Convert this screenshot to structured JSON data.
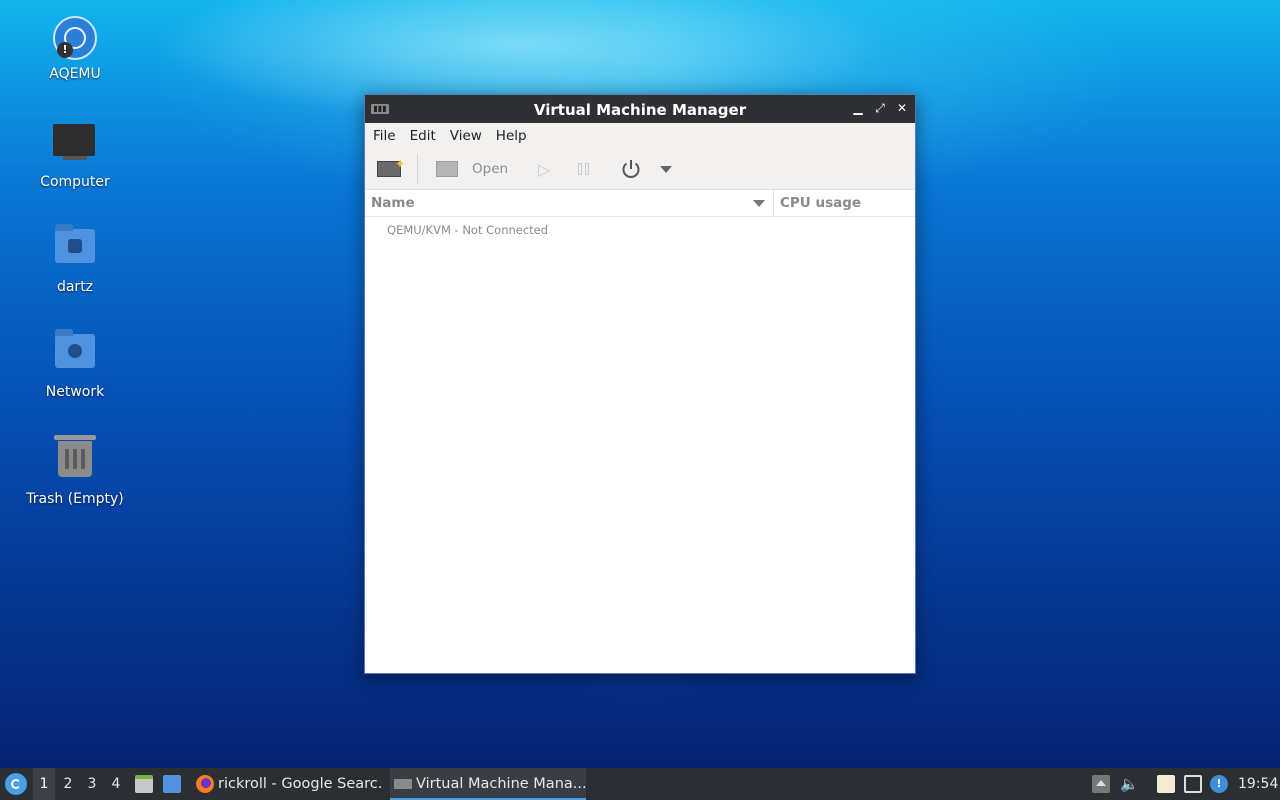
{
  "desktop": {
    "icons": [
      {
        "label": "AQEMU",
        "icon": "aqemu-icon"
      },
      {
        "label": "Computer",
        "icon": "computer-icon"
      },
      {
        "label": "dartz",
        "icon": "home-folder-icon"
      },
      {
        "label": "Network",
        "icon": "network-folder-icon"
      },
      {
        "label": "Trash (Empty)",
        "icon": "trash-icon"
      }
    ]
  },
  "window": {
    "title": "Virtual Machine Manager",
    "menu": [
      "File",
      "Edit",
      "View",
      "Help"
    ],
    "toolbar": {
      "open_label": "Open",
      "icons": [
        "new-vm-icon",
        "monitor-icon",
        "play-icon",
        "pause-icon",
        "power-icon",
        "dropdown-arrow-icon"
      ]
    },
    "columns": {
      "name": "Name",
      "cpu": "CPU usage"
    },
    "connections": [
      {
        "label": "QEMU/KVM - Not Connected"
      }
    ]
  },
  "taskbar": {
    "workspaces": [
      "1",
      "2",
      "3",
      "4"
    ],
    "active_workspace": "1",
    "tasks": [
      {
        "label": "rickroll - Google Searc..."
      },
      {
        "label": "Virtual Machine Mana..."
      }
    ],
    "clock": "19:54",
    "colors": {
      "accent": "#4aa0e8",
      "panel": "#2b2e33"
    }
  }
}
